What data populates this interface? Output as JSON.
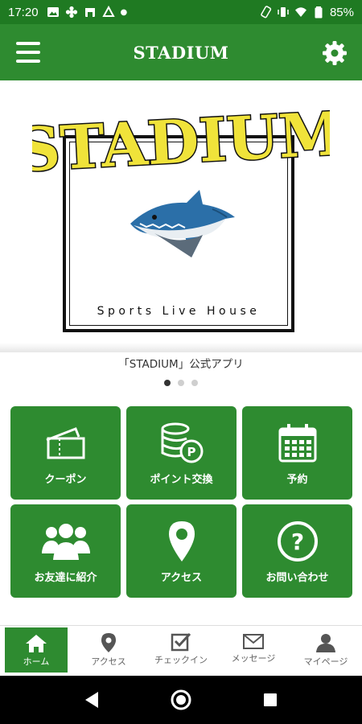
{
  "status_bar": {
    "time": "17:20",
    "battery": "85%"
  },
  "app_bar": {
    "title": "STADIUM"
  },
  "banner": {
    "logo_word": "STADIUM",
    "logo_sub": "Sports Live House",
    "caption": "「STADIUM」公式アプリ",
    "slide_count": 3,
    "active_slide": 1
  },
  "tiles": [
    {
      "label": "クーポン",
      "icon": "ticket-icon"
    },
    {
      "label": "ポイント交換",
      "icon": "coin-stack-icon"
    },
    {
      "label": "予約",
      "icon": "calendar-icon"
    },
    {
      "label": "お友達に紹介",
      "icon": "group-icon"
    },
    {
      "label": "アクセス",
      "icon": "map-pin-icon"
    },
    {
      "label": "お問い合わせ",
      "icon": "question-icon"
    }
  ],
  "bottom_nav": [
    {
      "label": "ホーム",
      "icon": "home-icon",
      "active": true
    },
    {
      "label": "アクセス",
      "icon": "map-pin-icon",
      "active": false
    },
    {
      "label": "チェックイン",
      "icon": "checkbox-icon",
      "active": false
    },
    {
      "label": "メッセージ",
      "icon": "envelope-icon",
      "active": false
    },
    {
      "label": "マイページ",
      "icon": "person-icon",
      "active": false
    }
  ],
  "colors": {
    "primary": "#2e8b30",
    "status_bar": "#1f7a22",
    "logo_yellow": "#f0e33a"
  }
}
